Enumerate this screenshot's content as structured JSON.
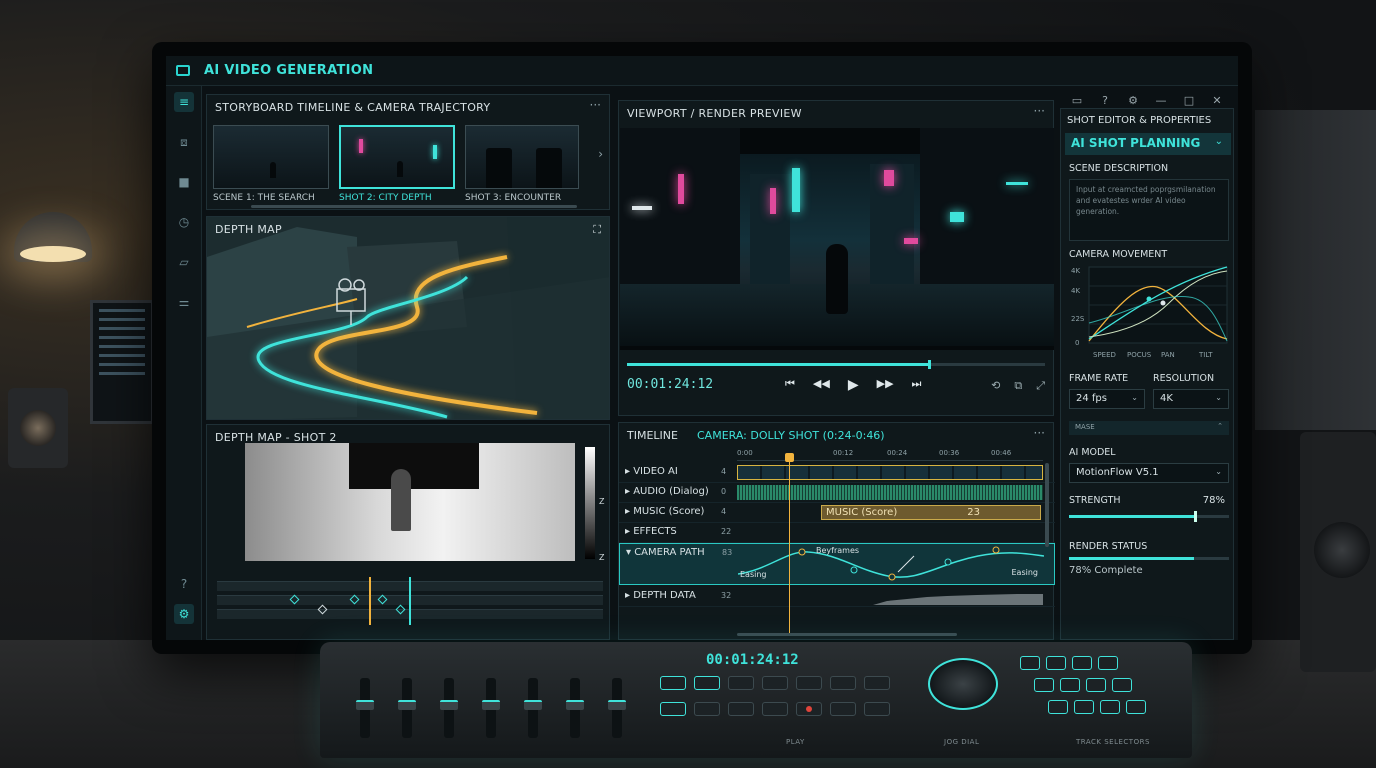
{
  "app": {
    "title": "AI VIDEO GENERATION"
  },
  "window_controls": [
    "monitor",
    "help",
    "settings",
    "minimize",
    "maximize",
    "close"
  ],
  "rail": [
    "menu",
    "code",
    "camera",
    "history",
    "folder",
    "sliders",
    "help",
    "settings"
  ],
  "storyboard": {
    "title": "STORYBOARD TIMELINE & CAMERA TRAJECTORY",
    "shots": [
      {
        "caption": "SCENE 1: THE SEARCH",
        "selected": false
      },
      {
        "caption": "SHOT 2: CITY DEPTH",
        "selected": true
      },
      {
        "caption": "SHOT 3: ENCOUNTER",
        "selected": false
      }
    ]
  },
  "depth_map": {
    "title": "DEPTH MAP"
  },
  "depth_map_shot": {
    "title": "DEPTH MAP - SHOT 2",
    "z_top": "Z",
    "z_bottom": "Z"
  },
  "viewport": {
    "title": "VIEWPORT / RENDER PREVIEW",
    "timecode": "00:01:24:12",
    "progress": 0.72
  },
  "timeline": {
    "title": "TIMELINE",
    "camera_label": "CAMERA: DOLLY SHOT (0:24-0:46)",
    "ruler": [
      "0:00",
      "00:12",
      "00:24",
      "00:36",
      "00:46"
    ],
    "tracks": [
      {
        "name": "VIDEO AI",
        "icon": "4"
      },
      {
        "name": "AUDIO (Dialog)",
        "icon": "0"
      },
      {
        "name": "MUSIC (Score)",
        "icon": "4"
      },
      {
        "name": "EFFECTS",
        "icon": "22"
      },
      {
        "name": "CAMERA PATH",
        "icon": "83"
      },
      {
        "name": "DEPTH DATA",
        "icon": "32"
      }
    ],
    "music_clip": "MUSIC (Score)",
    "music_clip_marker": "23",
    "camera_keyframes": "Beyframes",
    "camera_ease_in": "Easing",
    "camera_ease_out": "Easing"
  },
  "properties": {
    "title": "SHOT EDITOR & PROPERTIES",
    "section": "AI SHOT PLANNING",
    "scene_description_label": "SCENE DESCRIPTION",
    "scene_description": "Input at creamcted poprgsmilanation and evatestes wrder AI video generation.",
    "camera_movement_label": "CAMERA MOVEMENT",
    "chart_y_labels": [
      "4K",
      "4K",
      "22S",
      "0"
    ],
    "chart_x_labels": [
      "SPEED",
      "POCUS",
      "PAN",
      "TILT"
    ],
    "frame_rate_label": "FRAME RATE",
    "frame_rate": "24 fps",
    "resolution_label": "RESOLUTION",
    "resolution": "4K",
    "mask_label": "MASE",
    "ai_model_label": "AI MODEL",
    "ai_model": "MotionFlow V5.1",
    "strength_label": "STRENGTH",
    "strength": "78%",
    "strength_value": 0.78,
    "render_status_label": "RENDER STATUS",
    "render_status": "78% Complete",
    "render_progress": 0.78
  },
  "console": {
    "timecode": "00:01:24:12",
    "labels": [
      "PLAY",
      "JOG DIAL",
      "TRACK SELECTORS"
    ]
  },
  "colors": {
    "accent": "#3fe3da",
    "playhead": "#f2b33d",
    "neon_pink": "#e04a9d"
  }
}
